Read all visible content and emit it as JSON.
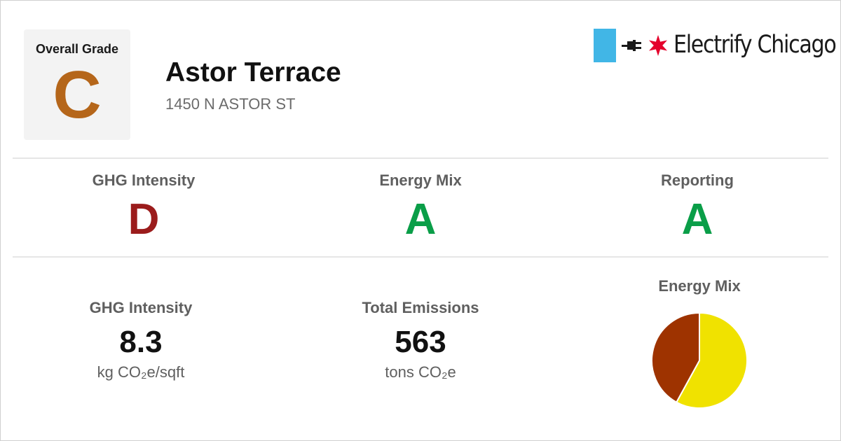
{
  "header": {
    "overall_grade_label": "Overall Grade",
    "overall_grade": "C",
    "overall_grade_color": "#b5661a",
    "building_name": "Astor Terrace",
    "building_address": "1450 N ASTOR ST"
  },
  "brand": {
    "name": "Electrify Chicago",
    "square_color": "#41b6e6",
    "star_color": "#e4002b",
    "icons": [
      "plug-icon",
      "chicago-star-icon"
    ]
  },
  "grades": [
    {
      "label": "GHG Intensity",
      "grade": "D",
      "color": "#9b1c1c"
    },
    {
      "label": "Energy Mix",
      "grade": "A",
      "color": "#0a9e48"
    },
    {
      "label": "Reporting",
      "grade": "A",
      "color": "#0a9e48"
    }
  ],
  "stats": [
    {
      "label": "GHG Intensity",
      "value": "8.3",
      "unit": "kg CO₂e/sqft"
    },
    {
      "label": "Total Emissions",
      "value": "563",
      "unit": "tons CO₂e"
    }
  ],
  "energy_mix": {
    "title": "Energy Mix"
  },
  "chart_data": {
    "type": "pie",
    "title": "Energy Mix",
    "slices": [
      {
        "value": 0.58,
        "color": "#f0e200"
      },
      {
        "value": 0.42,
        "color": "#9e3300"
      }
    ]
  }
}
